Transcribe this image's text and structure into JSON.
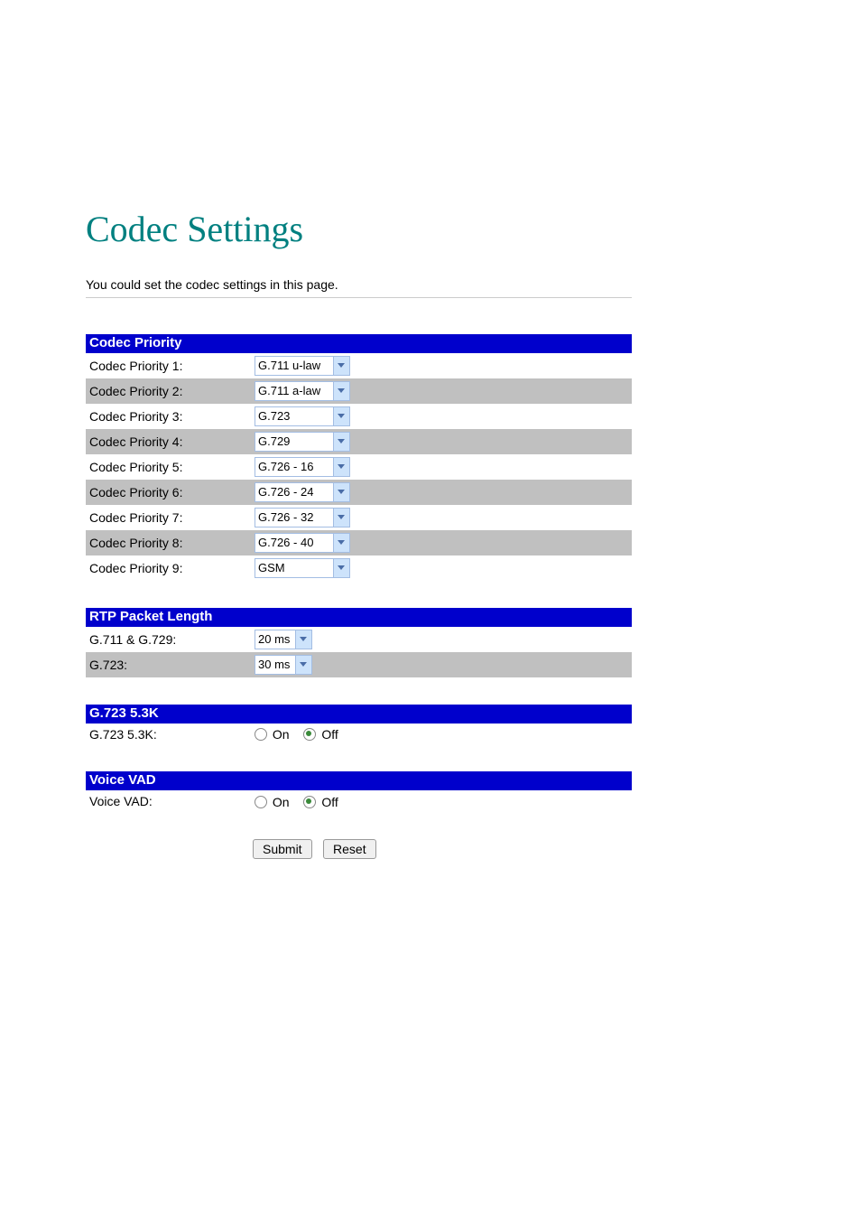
{
  "title": "Codec Settings",
  "description": "You could set the codec settings in this page.",
  "sections": {
    "codec_priority": {
      "header": "Codec Priority",
      "rows": [
        {
          "label": "Codec Priority 1:",
          "value": "G.711 u-law"
        },
        {
          "label": "Codec Priority 2:",
          "value": "G.711 a-law"
        },
        {
          "label": "Codec Priority 3:",
          "value": "G.723"
        },
        {
          "label": "Codec Priority 4:",
          "value": "G.729"
        },
        {
          "label": "Codec Priority 5:",
          "value": "G.726 - 16"
        },
        {
          "label": "Codec Priority 6:",
          "value": "G.726 - 24"
        },
        {
          "label": "Codec Priority 7:",
          "value": "G.726 - 32"
        },
        {
          "label": "Codec Priority 8:",
          "value": "G.726 - 40"
        },
        {
          "label": "Codec Priority 9:",
          "value": "GSM"
        }
      ]
    },
    "rtp_packet_length": {
      "header": "RTP Packet Length",
      "rows": [
        {
          "label": "G.711 & G.729:",
          "value": "20 ms"
        },
        {
          "label": "G.723:",
          "value": "30 ms"
        }
      ]
    },
    "g723_53k": {
      "header": "G.723 5.3K",
      "label": "G.723 5.3K:",
      "on": "On",
      "off": "Off",
      "value": "Off"
    },
    "voice_vad": {
      "header": "Voice VAD",
      "label": "Voice VAD:",
      "on": "On",
      "off": "Off",
      "value": "Off"
    }
  },
  "buttons": {
    "submit": "Submit",
    "reset": "Reset"
  }
}
